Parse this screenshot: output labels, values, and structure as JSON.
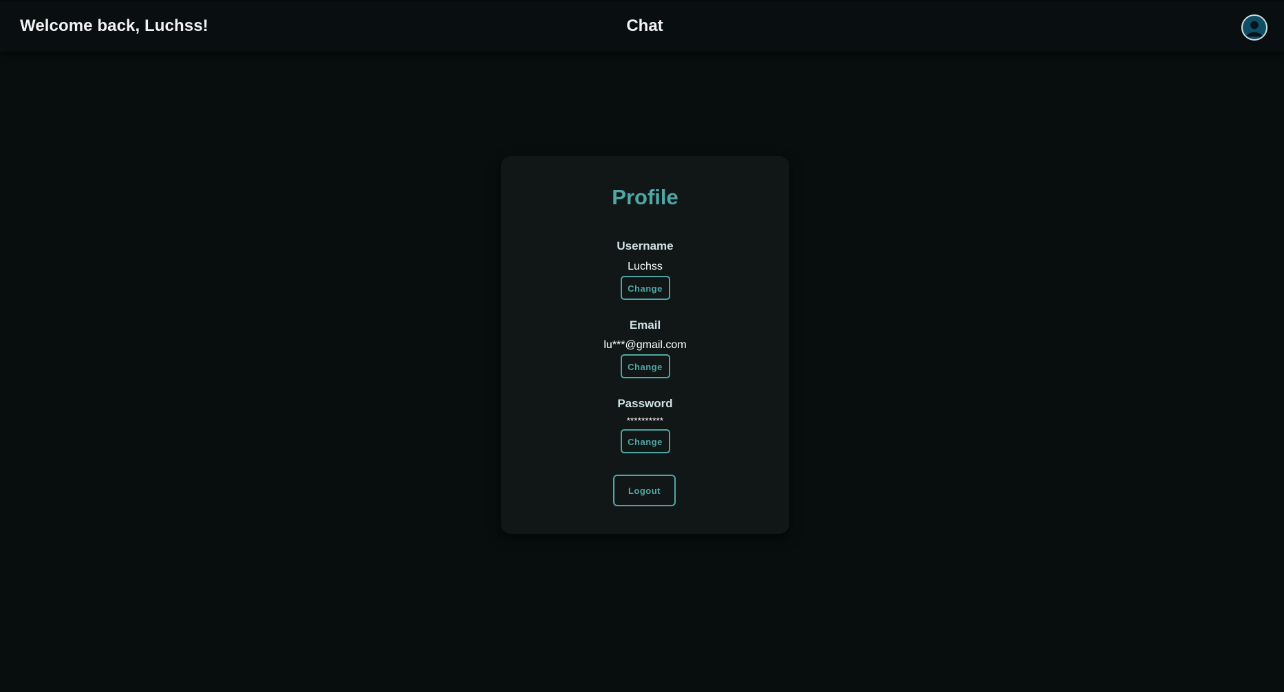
{
  "header": {
    "welcome_text": "Welcome back, Luchss!",
    "nav_chat": "Chat",
    "avatar_icon": "user-avatar-icon"
  },
  "profile": {
    "title": "Profile",
    "username": {
      "label": "Username",
      "value": "Luchss",
      "button": "Change"
    },
    "email": {
      "label": "Email",
      "value": "lu***@gmail.com",
      "button": "Change"
    },
    "password": {
      "label": "Password",
      "value": "**********",
      "button": "Change"
    },
    "logout_button": "Logout"
  },
  "colors": {
    "background": "#080d0e",
    "card": "#111617",
    "accent": "#4fa8a6",
    "label": "#cfe3e6",
    "avatar_fill": "#0f4f66"
  }
}
